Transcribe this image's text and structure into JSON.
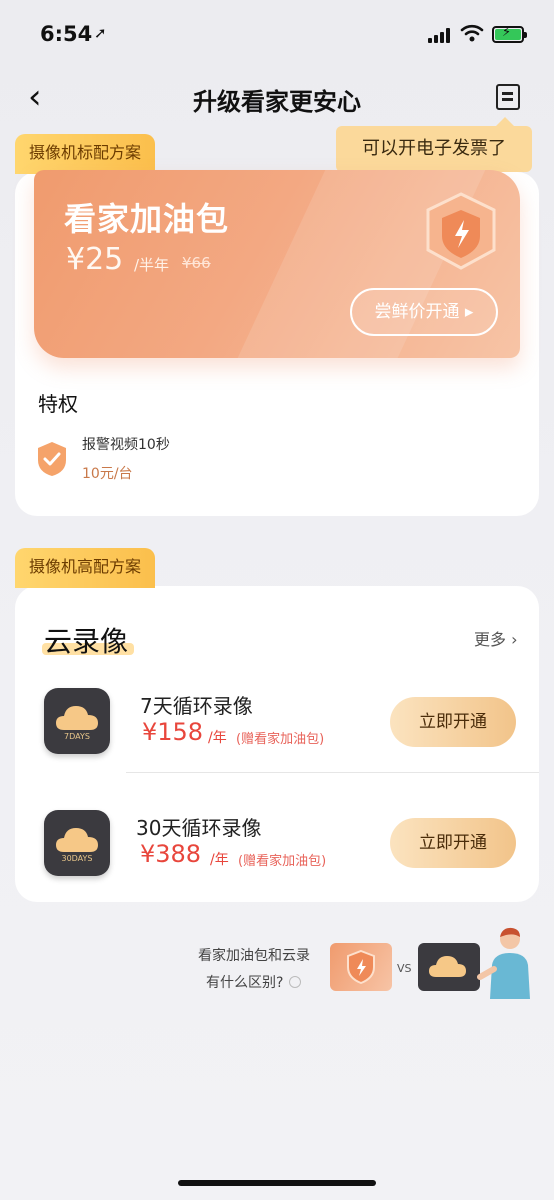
{
  "status_bar": {
    "time": "6:54",
    "location_glyph": "➚"
  },
  "nav": {
    "back_glyph": "‹",
    "title": "升级看家更安心",
    "invoice_tooltip": "可以开电子发票了"
  },
  "section1": {
    "tag": "摄像机标配方案",
    "promo": {
      "title": "看家加油包",
      "price": "¥25",
      "unit": "/半年",
      "original_price": "¥66",
      "button_label": "尝鲜价开通 ▸"
    },
    "privileges_title": "特权",
    "privileges": [
      {
        "name": "报警视频10秒",
        "detail": "10元/台"
      }
    ]
  },
  "section2": {
    "tag": "摄像机高配方案",
    "title": "云录像",
    "more_label": "更多 ›",
    "plans": [
      {
        "name": "7天循环录像",
        "price": "¥158",
        "unit": "/年",
        "note": "(赠看家加油包)",
        "button_label": "立即开通",
        "icon_label": "7DAYS"
      },
      {
        "name": "30天循环录像",
        "price": "¥388",
        "unit": "/年",
        "note": "(赠看家加油包)",
        "button_label": "立即开通",
        "icon_label": "30DAYS"
      }
    ]
  },
  "compare": {
    "line1": "看家加油包和云录",
    "line2": "有什么区别?",
    "vs": "VS"
  },
  "colors": {
    "accent_orange": "#f09b6e",
    "price_red": "#e8463c",
    "tag_yellow": "#fbbf4c",
    "button_gold": "#f2c48a"
  }
}
